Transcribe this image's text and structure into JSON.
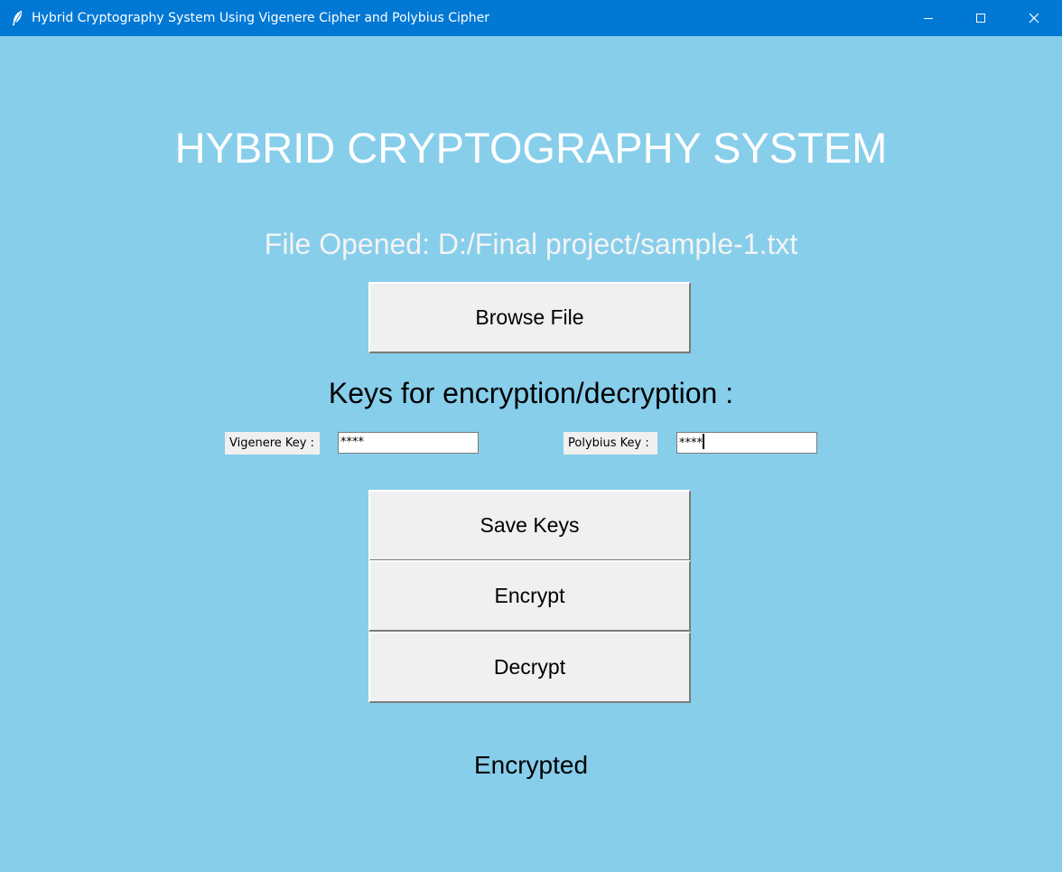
{
  "window": {
    "title": "Hybrid Cryptography System Using Vigenere Cipher and Polybius Cipher",
    "icon": "feather-icon",
    "controls": [
      "minimize-icon",
      "maximize-icon",
      "close-icon"
    ],
    "background": "#87ceeb",
    "titlebar_color": "#0078d4"
  },
  "header": {
    "title": "HYBRID CRYPTOGRAPHY SYSTEM"
  },
  "file": {
    "opened_text": "File Opened: D:/Final project/sample-1.txt",
    "browse_label": "Browse File"
  },
  "keys": {
    "heading": "Keys for encryption/decryption :",
    "vigenere_label": "Vigenere Key :",
    "vigenere_value": "****",
    "polybius_label": "Polybius Key :",
    "polybius_value": "****"
  },
  "actions": {
    "save_label": "Save Keys",
    "encrypt_label": "Encrypt",
    "decrypt_label": "Decrypt"
  },
  "status": {
    "text": "Encrypted"
  }
}
